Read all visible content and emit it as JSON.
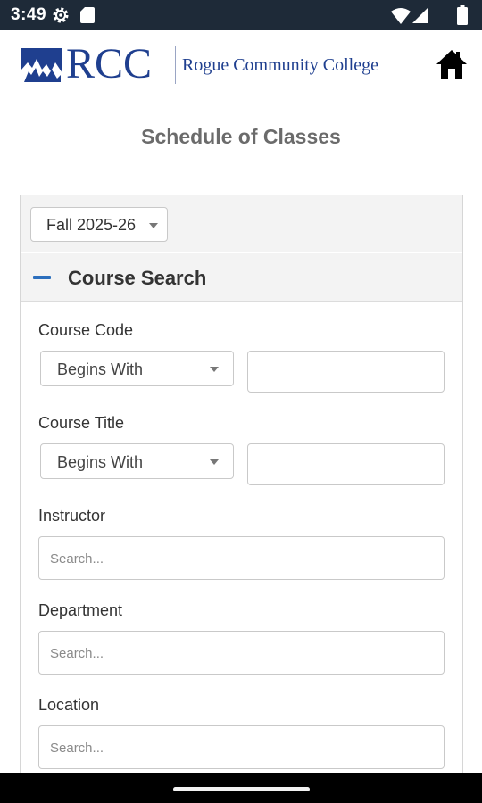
{
  "status_bar": {
    "time": "3:49",
    "icons": [
      "gear-icon",
      "sd-card-icon",
      "wifi-icon",
      "signal-icon",
      "battery-icon"
    ]
  },
  "header": {
    "logo_text": "RCC",
    "college_name": "Rogue Community College",
    "brand_color": "#1f3f8f",
    "home_icon": "home-icon"
  },
  "page": {
    "title": "Schedule of Classes"
  },
  "term": {
    "selected": "Fall 2025-26"
  },
  "course_search": {
    "title": "Course Search",
    "accent_color": "#2c6fbd",
    "fields": {
      "course_code": {
        "label": "Course Code",
        "match": "Begins With",
        "value": ""
      },
      "course_title": {
        "label": "Course Title",
        "match": "Begins With",
        "value": ""
      },
      "instructor": {
        "label": "Instructor",
        "placeholder": "Search..."
      },
      "department": {
        "label": "Department",
        "placeholder": "Search..."
      },
      "location": {
        "label": "Location",
        "placeholder": "Search..."
      }
    }
  }
}
